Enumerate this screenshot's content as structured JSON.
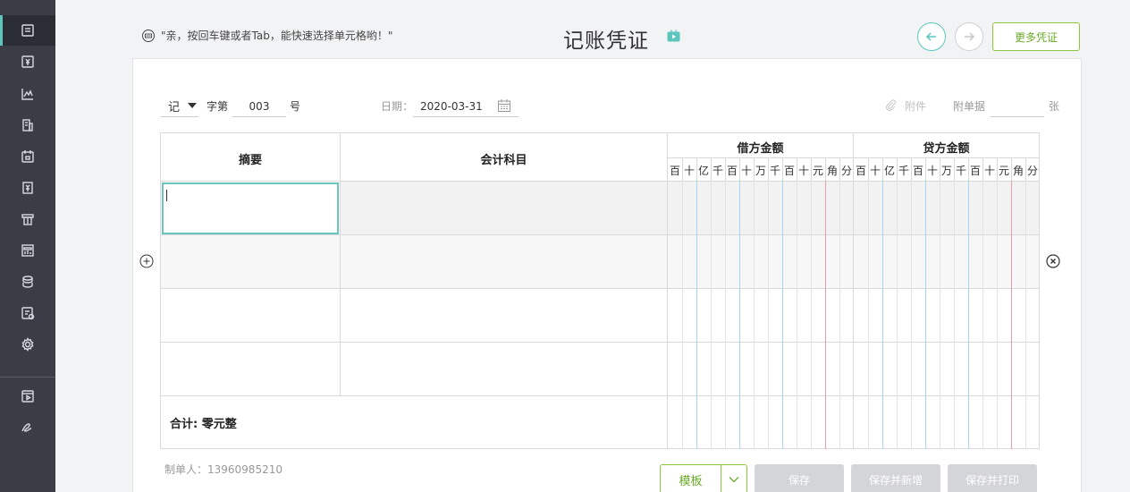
{
  "colors": {
    "sidebar": "#3a3d46",
    "accent_teal": "#5bc5be",
    "accent_green": "#8dc63f",
    "disabled_btn": "#d4d5d8"
  },
  "sidebar": {
    "items": [
      {
        "icon": "voucher-icon",
        "active": true
      },
      {
        "icon": "ledger-icon"
      },
      {
        "icon": "chart-icon"
      },
      {
        "icon": "building-icon"
      },
      {
        "icon": "calendar-icon"
      },
      {
        "icon": "report-icon"
      },
      {
        "icon": "invoice-icon"
      },
      {
        "icon": "dashboard-icon"
      },
      {
        "icon": "stack-icon"
      },
      {
        "icon": "tax-icon"
      },
      {
        "icon": "gear-icon"
      },
      {
        "icon": "video-icon"
      },
      {
        "icon": "signature-icon"
      }
    ]
  },
  "header": {
    "hint": "\"亲，按回车键或者Tab，能快速选择单元格哟！\"",
    "title": "记账凭证",
    "more_button": "更多凭证"
  },
  "form": {
    "voucher_type": "记",
    "zi_label": "字第",
    "voucher_number": "003",
    "hao_label": "号",
    "date_label": "日期：",
    "date_value": "2020-03-31",
    "attachment_label": "附件",
    "attach_docs_label": "附单据",
    "attach_docs_count": "",
    "zhang_label": "张"
  },
  "table": {
    "col_summary": "摘要",
    "col_account": "会计科目",
    "col_debit": "借方金额",
    "col_credit": "贷方金额",
    "units": [
      "百",
      "十",
      "亿",
      "千",
      "百",
      "十",
      "万",
      "千",
      "百",
      "十",
      "元",
      "角",
      "分"
    ],
    "rows": [
      {
        "summary": "",
        "account": ""
      },
      {
        "summary": "",
        "account": ""
      },
      {
        "summary": "",
        "account": ""
      },
      {
        "summary": "",
        "account": ""
      }
    ],
    "total_label": "合计:  零元整"
  },
  "footer": {
    "maker": "制单人：13960985210",
    "template_button": "模板",
    "save_button": "保存",
    "save_new_button": "保存并新增",
    "save_print_button": "保存并打印"
  }
}
